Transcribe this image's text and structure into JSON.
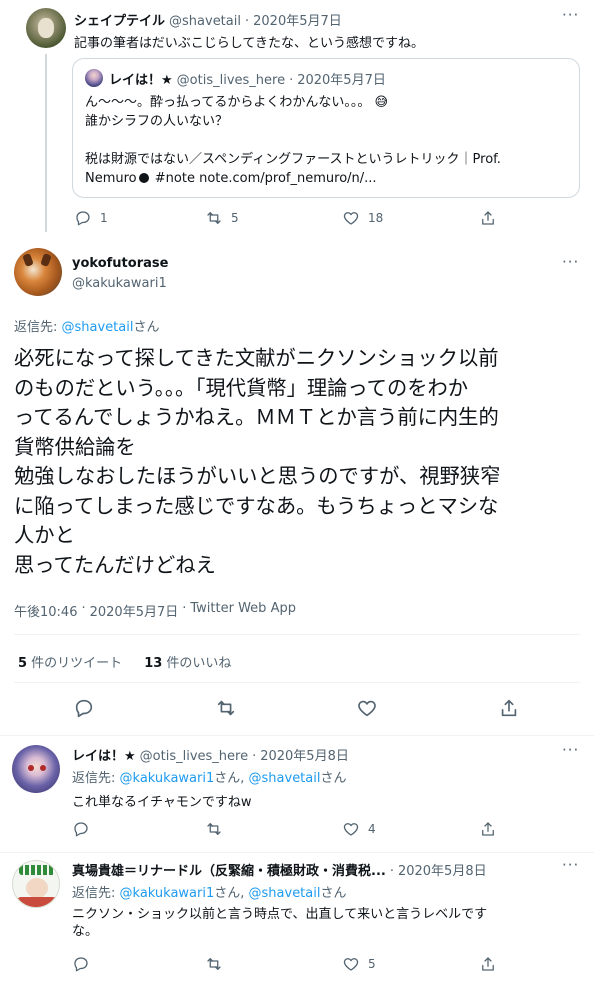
{
  "tweet1": {
    "display_name": "シェイプテイル",
    "handle": "@shavetail",
    "separator": "·",
    "date": "2020年5月7日",
    "text": "記事の筆者はだいぶこじらしてきたな、という感想ですね。",
    "quote": {
      "display_name": "レイは！★",
      "handle": "@otis_lives_here",
      "separator": "·",
      "date": "2020年5月7日",
      "line1": "ん〜〜〜。酔っ払ってるからよくわかんない。。。",
      "emoji": "😅",
      "line2": "誰かシラフの人いない？",
      "line3": "税は財源ではない／スペンディングファーストというレトリック｜Prof.",
      "line4_prefix": "Nemuro",
      "line4_suffix": " #note note.com/prof_nemuro/n/..."
    },
    "actions": {
      "replies": "1",
      "retweets": "5",
      "likes": "18"
    }
  },
  "main_tweet": {
    "display_name": "yokofutorase",
    "handle": "@kakukawari1",
    "reply_prefix": "返信先: ",
    "reply_to": "@shavetail",
    "reply_suffix": "さん",
    "lines": [
      "必死になって探してきた文献がニクソンショック以前",
      "のものだという。。。「現代貨幣」理論ってのをわか",
      "ってるんでしょうかねえ。ＭＭＴとか言う前に内生的",
      "貨幣供給論を",
      "勉強しなおしたほうがいいと思うのですが、視野狭窄",
      "に陥ってしまった感じですなあ。もうちょっとマシな",
      "人かと",
      "思ってたんだけどねえ"
    ],
    "time": "午後10:46",
    "separator": "·",
    "date": "2020年5月7日",
    "client": "Twitter Web App",
    "retweet_count": "5",
    "retweet_label": " 件のリツイート",
    "like_count": "13",
    "like_label": " 件のいいね"
  },
  "reply1": {
    "display_name": "レイは！★",
    "handle": "@otis_lives_here",
    "separator": "·",
    "date": "2020年5月8日",
    "reply_prefix": "返信先: ",
    "reply_to_1": "@kakukawari1",
    "reply_mid": "さん, ",
    "reply_to_2": "@shavetail",
    "reply_suffix": "さん",
    "text": "これ単なるイチャモンですねw",
    "likes": "4"
  },
  "reply2": {
    "display_name": "真場貴雄＝リナードル（反緊縮・積極財政・消費税...",
    "separator": "·",
    "date": "2020年5月8日",
    "reply_prefix": "返信先: ",
    "reply_to_1": "@kakukawari1",
    "reply_mid": "さん, ",
    "reply_to_2": "@shavetail",
    "reply_suffix": "さん",
    "line1": "ニクソン・ショック以前と言う時点で、出直して来いと言うレベルです",
    "line2": "な。",
    "likes": "5"
  },
  "more_label": "···"
}
